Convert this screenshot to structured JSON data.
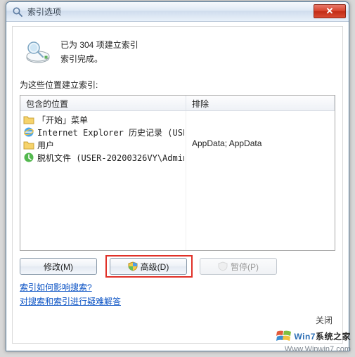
{
  "window": {
    "title": "索引选项",
    "close_glyph": "✕"
  },
  "status": {
    "line1": "已为 304 项建立索引",
    "line2": "索引完成。"
  },
  "section_label": "为这些位置建立索引:",
  "columns": {
    "included": "包含的位置",
    "excluded": "排除"
  },
  "included_items": [
    {
      "icon": "folder",
      "label": "「开始」菜单"
    },
    {
      "icon": "ie",
      "label": "Internet Explorer 历史记录 (USE..."
    },
    {
      "icon": "folder",
      "label": "用户"
    },
    {
      "icon": "offline",
      "label": "脱机文件 (USER-20200326VY\\Admin..."
    }
  ],
  "excluded_text": "AppData; AppData",
  "buttons": {
    "modify": "修改(M)",
    "advanced": "高级(D)",
    "pause": "暂停(P)"
  },
  "links": {
    "help1": "索引如何影响搜索?",
    "help2": "对搜索和索引进行疑难解答"
  },
  "inner_close": "关闭",
  "watermark": {
    "brand_prefix": "Win7",
    "brand_suffix": "系统之家",
    "url": "Www.Winwin7.com"
  }
}
